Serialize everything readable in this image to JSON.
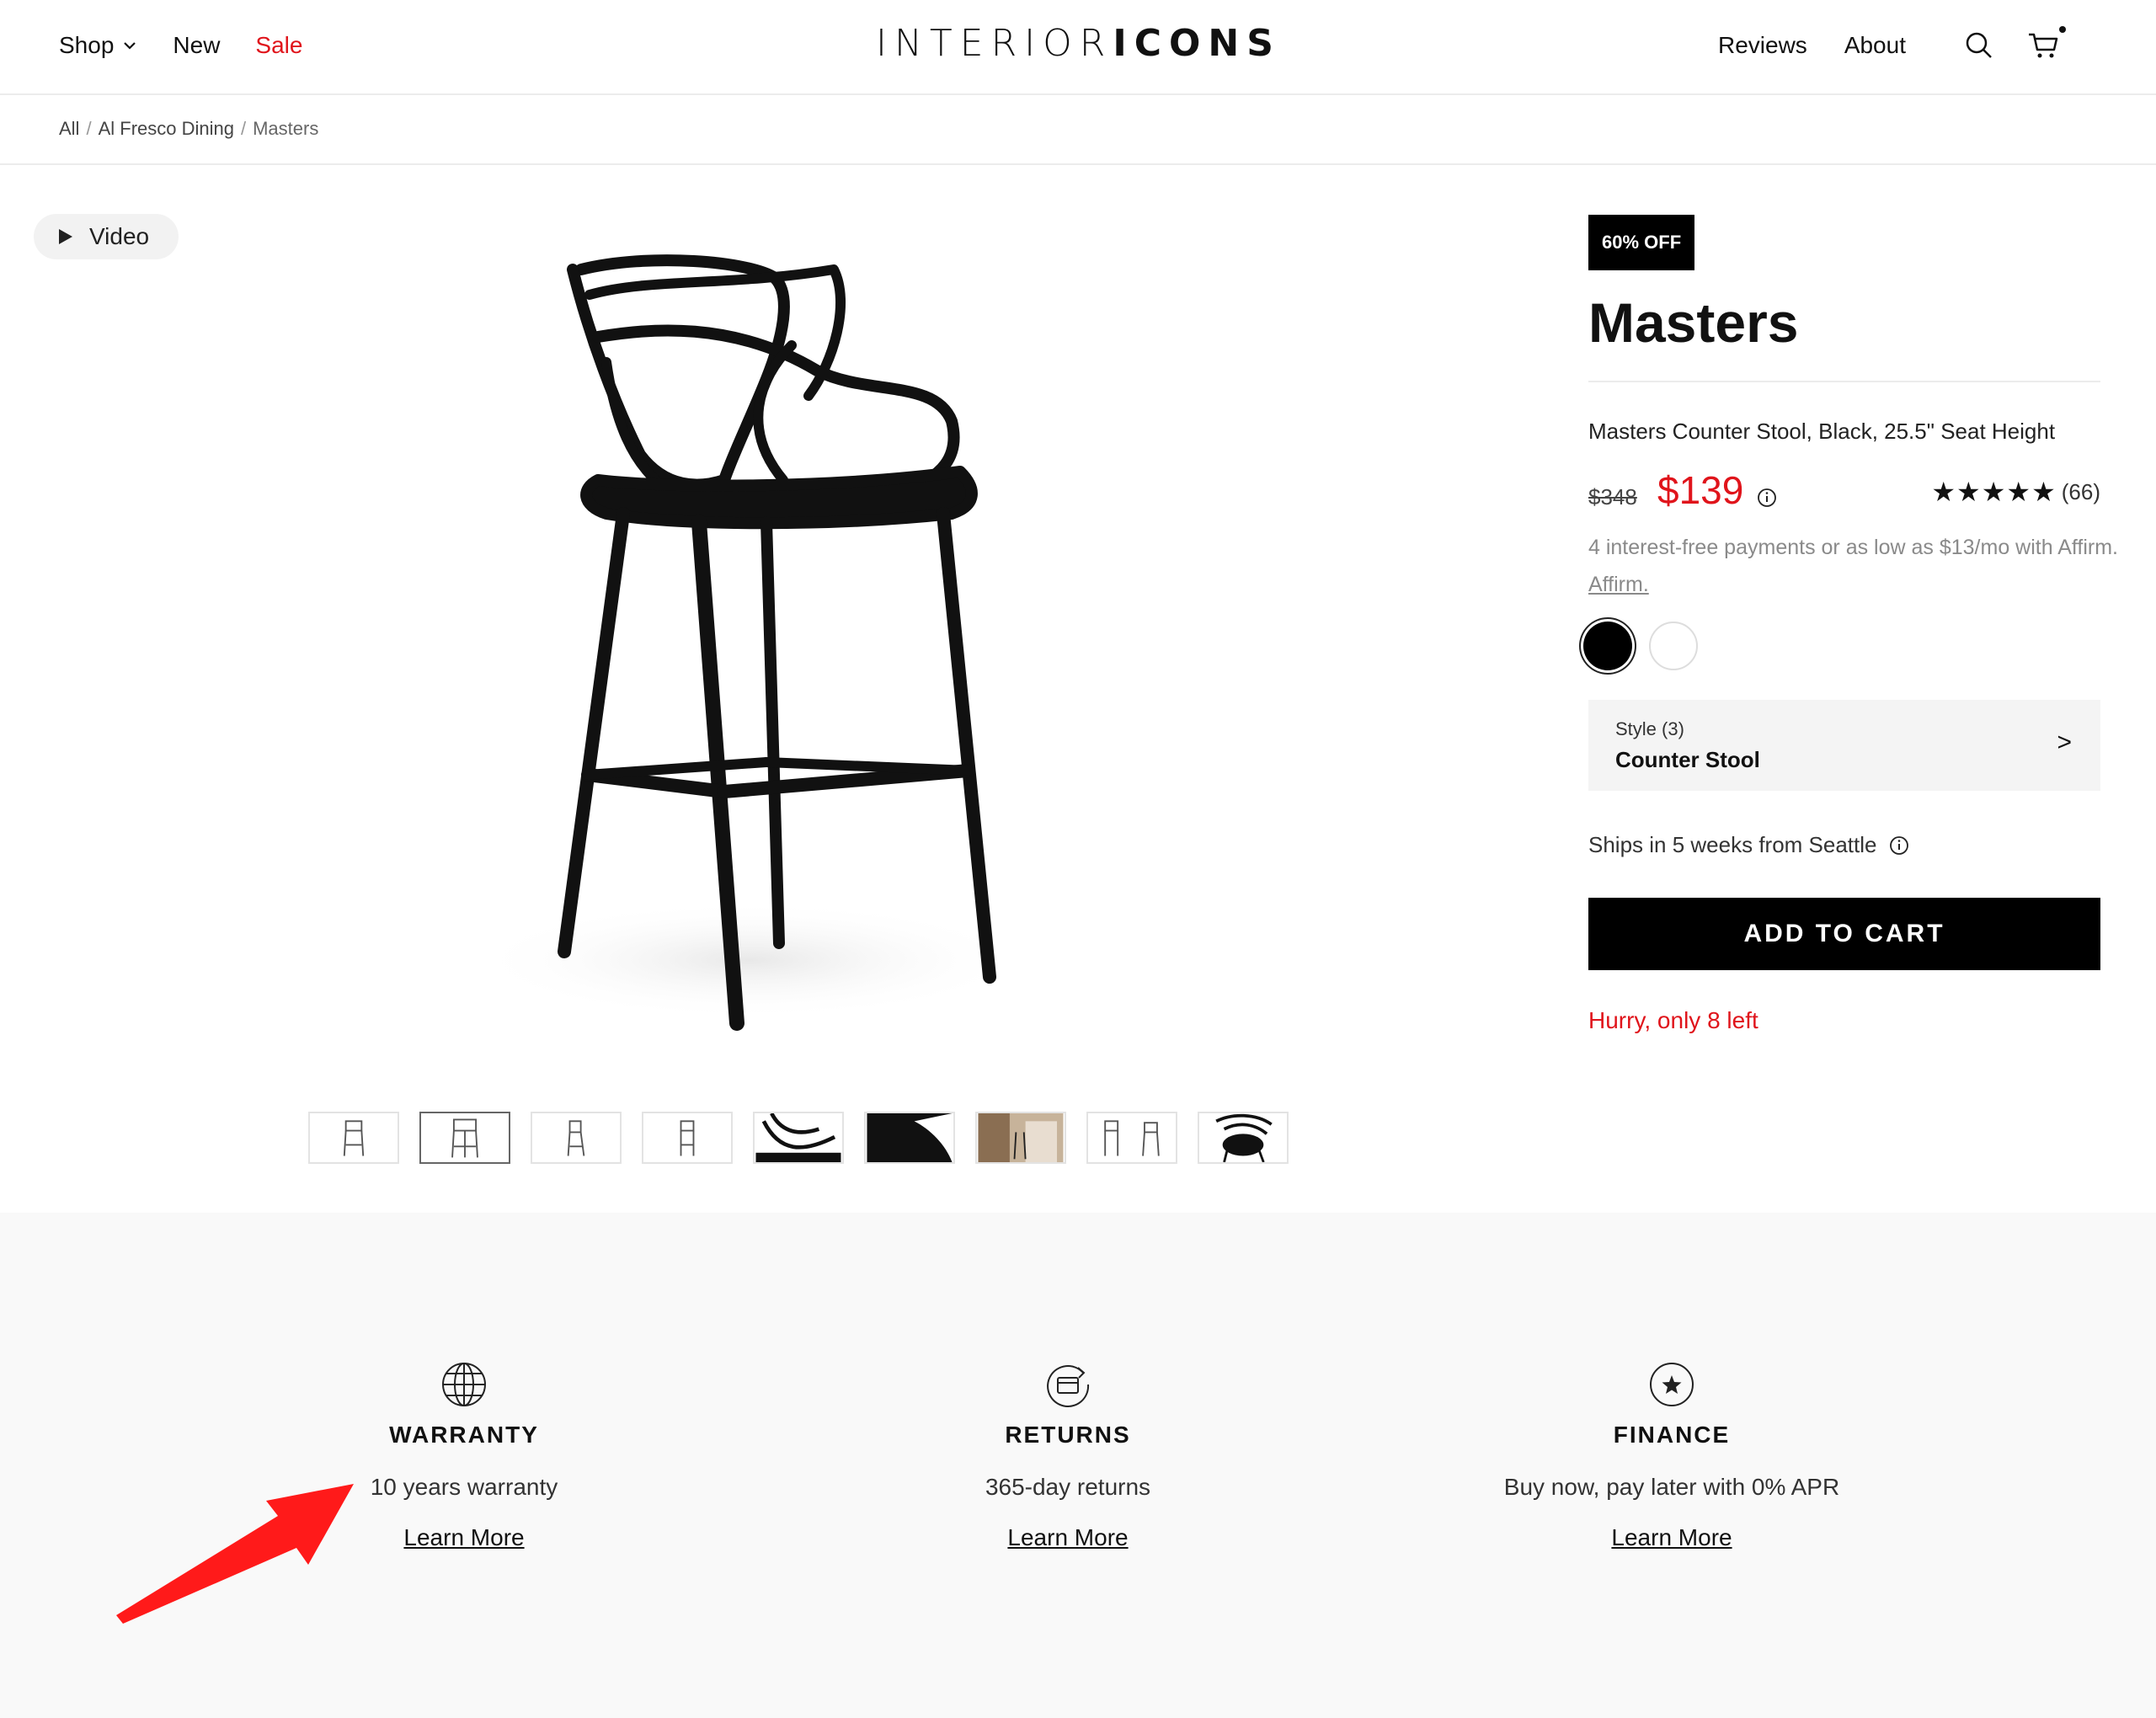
{
  "header": {
    "nav_left": {
      "shop": "Shop",
      "new": "New",
      "sale": "Sale"
    },
    "logo": {
      "part1": "INTERIOR",
      "part2": "ICONS"
    },
    "nav_right": {
      "reviews": "Reviews",
      "about": "About"
    },
    "icons": [
      "search-icon",
      "cart-icon"
    ]
  },
  "breadcrumb": {
    "items": [
      "All",
      "Al Fresco Dining",
      "Masters"
    ],
    "separator": "/"
  },
  "gallery": {
    "video_label": "Video",
    "thumbnails_count": 9,
    "active_thumbnail": 2
  },
  "product": {
    "badge": "60% OFF",
    "title": "Masters",
    "subtitle": "Masters Counter Stool, Black, 25.5\" Seat Height",
    "old_price": "$348",
    "price": "$139",
    "rating_stars": "★★★★★",
    "rating_value": 5,
    "rating_count": "(66)",
    "affirm_text": "4 interest-free payments or as low as $13/mo with Affirm.",
    "affirm_link": "Affirm.",
    "swatches": [
      {
        "name": "Black",
        "color": "#000000",
        "selected": true
      },
      {
        "name": "White",
        "color": "#ffffff",
        "selected": false
      }
    ],
    "style": {
      "label": "Style (3)",
      "value": "Counter Stool",
      "arrow": ">"
    },
    "ships": "Ships in 5 weeks from Seattle",
    "add_to_cart": "ADD TO CART",
    "stock_notice": "Hurry, only 8 left"
  },
  "benefits": [
    {
      "icon": "globe-icon",
      "title": "WARRANTY",
      "desc": "10 years warranty",
      "link": "Learn More"
    },
    {
      "icon": "returns-icon",
      "title": "RETURNS",
      "desc": "365-day returns",
      "link": "Learn More"
    },
    {
      "icon": "star-circle-icon",
      "title": "FINANCE",
      "desc": "Buy now, pay later with 0% APR",
      "link": "Learn More"
    }
  ],
  "colors": {
    "accent_red": "#e0141b",
    "button_black": "#000000",
    "annotation_arrow": "#ff1a1a"
  }
}
